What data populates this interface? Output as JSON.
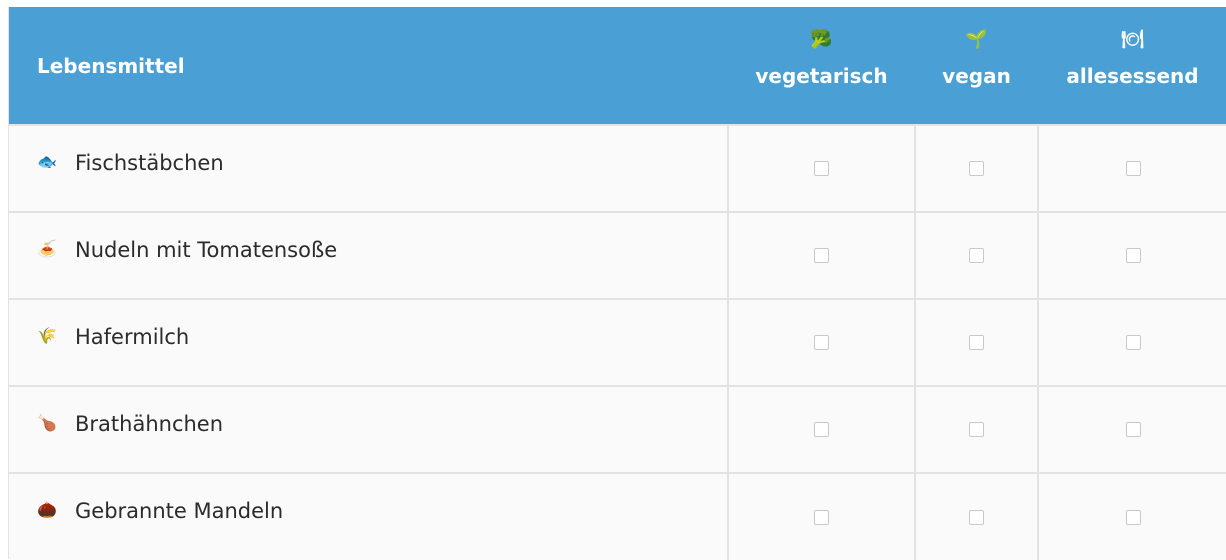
{
  "header": {
    "food_label": "Lebensmittel",
    "columns": [
      {
        "icon": "broccoli-icon",
        "glyph": "🥦",
        "label": "vegetarisch"
      },
      {
        "icon": "seedling-icon",
        "glyph": "🌱",
        "label": "vegan"
      },
      {
        "icon": "plate-icon",
        "glyph": "🍽",
        "label": "allesessend"
      }
    ]
  },
  "rows": [
    {
      "icon": "fish-icon",
      "glyph": "🐟",
      "name": "Fischstäbchen",
      "vegetarisch": false,
      "vegan": false,
      "allesessend": false
    },
    {
      "icon": "spaghetti-icon",
      "glyph": "🍝",
      "name": "Nudeln mit Tomatensoße",
      "vegetarisch": false,
      "vegan": false,
      "allesessend": false
    },
    {
      "icon": "oat-icon",
      "glyph": "🌾",
      "name": "Hafermilch",
      "vegetarisch": false,
      "vegan": false,
      "allesessend": false
    },
    {
      "icon": "poultry-leg-icon",
      "glyph": "🍗",
      "name": "Brathähnchen",
      "vegetarisch": false,
      "vegan": false,
      "allesessend": false
    },
    {
      "icon": "chestnut-icon",
      "glyph": "🌰",
      "name": "Gebrannte Mandeln",
      "vegetarisch": false,
      "vegan": false,
      "allesessend": false
    }
  ],
  "colors": {
    "header_bg": "#4aa0d5",
    "header_text": "#ffffff",
    "row_bg": "#fafafa",
    "border": "#e3e3e3"
  }
}
